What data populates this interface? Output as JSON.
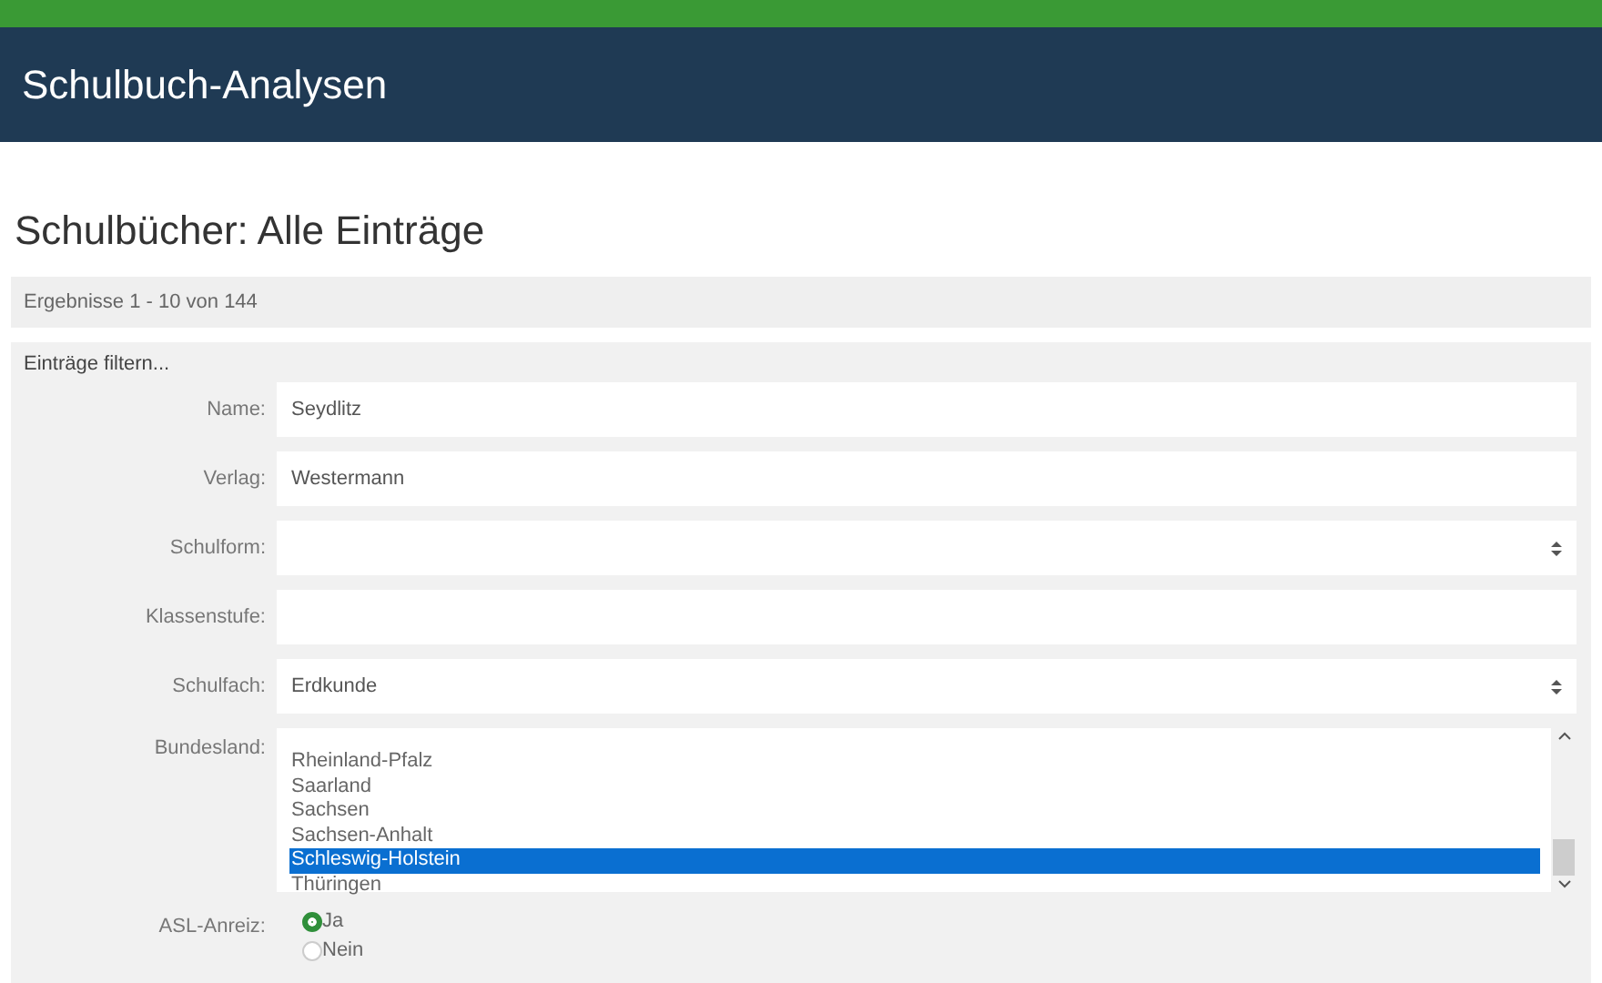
{
  "header": {
    "title": "Schulbuch-Analysen"
  },
  "page_title": "Schulbücher: Alle Einträge",
  "results": "Ergebnisse 1 - 10 von 144",
  "filter": {
    "title": "Einträge filtern...",
    "fields": [
      {
        "kind": "text",
        "label": "Name:",
        "value": "Seydlitz"
      },
      {
        "kind": "text",
        "label": "Verlag:",
        "value": "Westermann"
      },
      {
        "kind": "select",
        "label": "Schulform:"
      },
      {
        "kind": "text",
        "label": "Klassenstufe:"
      },
      {
        "kind": "select",
        "label": "Schulfach:",
        "value": "Erdkunde"
      }
    ],
    "listbox": {
      "label": "Bundesland:",
      "options": [
        {
          "label": "Rheinland-Pfalz",
          "selected": false
        },
        {
          "label": "Saarland",
          "selected": false
        },
        {
          "label": "Sachsen",
          "selected": false
        },
        {
          "label": "Sachsen-Anhalt",
          "selected": false
        },
        {
          "label": "Schleswig-Holstein",
          "selected": true
        },
        {
          "label": "Thüringen",
          "selected": false
        }
      ]
    },
    "radio": {
      "label": "ASL-Anreiz:",
      "options": [
        {
          "label": "Ja",
          "selected": true
        },
        {
          "label": "Nein",
          "selected": false
        }
      ]
    }
  }
}
